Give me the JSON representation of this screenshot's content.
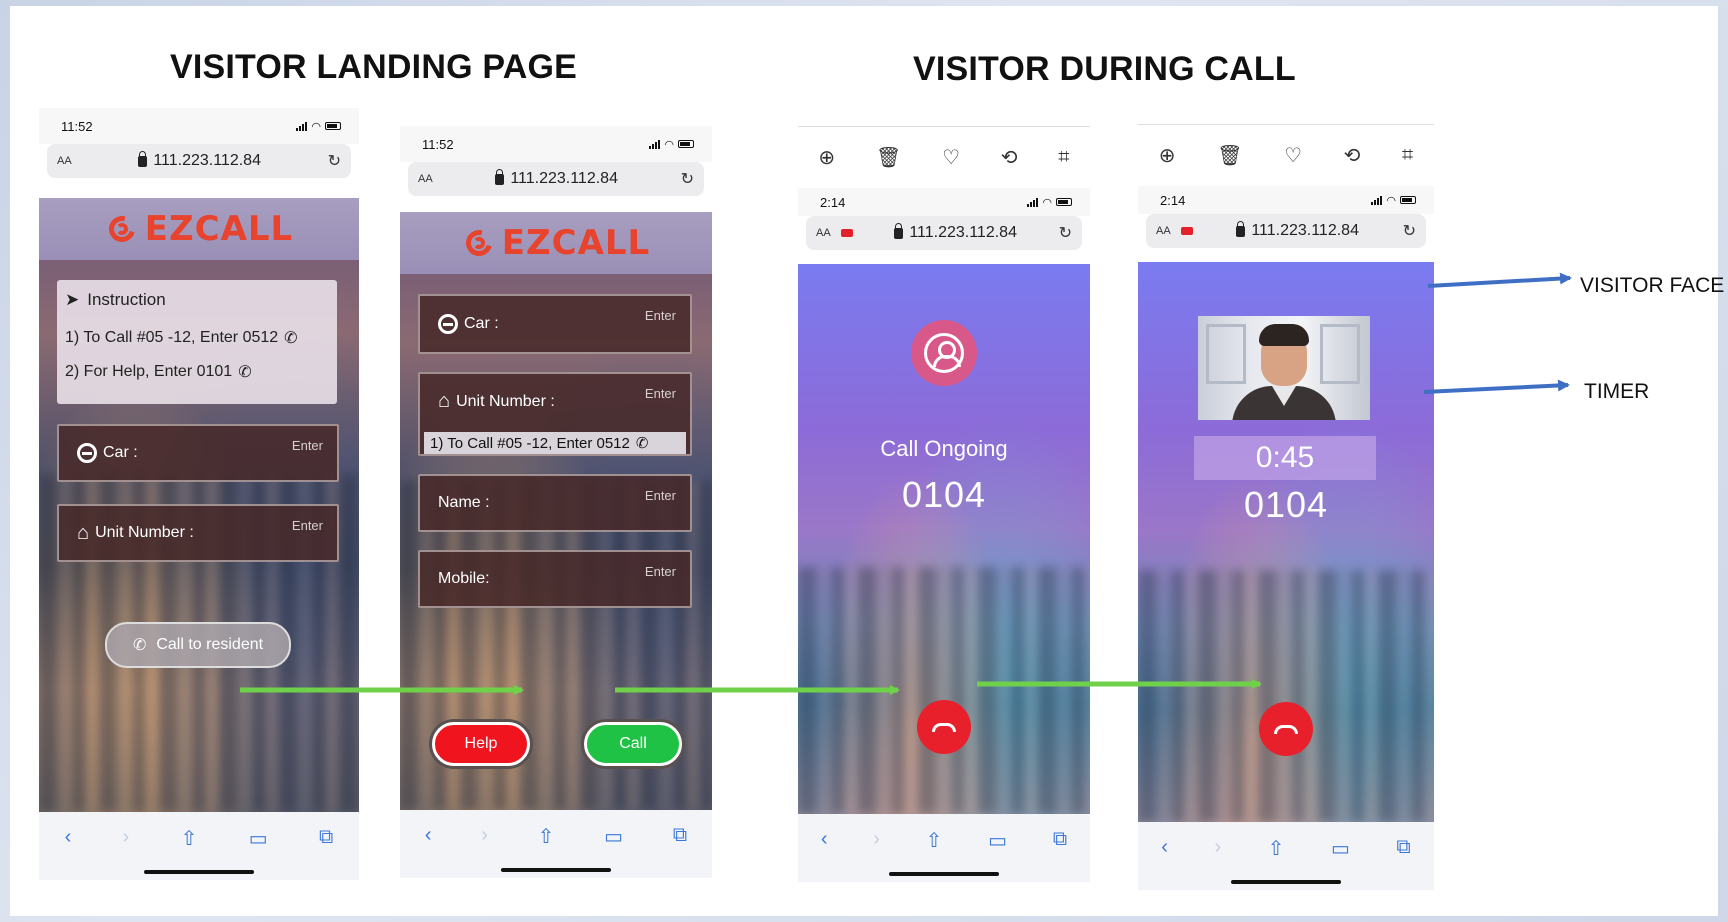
{
  "headings": {
    "landing": "VISITOR LANDING PAGE",
    "during_call": "VISITOR DURING CALL"
  },
  "phone1": {
    "time": "11:52",
    "url_aa": "AA",
    "url": "111.223.112.84",
    "logo": "EZCALL",
    "instruction_title": "Instruction",
    "instruction_lines": [
      "1) To Call #05 -12, Enter 0512",
      "2) For Help, Enter 0101"
    ],
    "field_car": "Car :",
    "field_unit": "Unit Number :",
    "enter_hint": "Enter",
    "call_button": "Call to resident"
  },
  "phone2": {
    "time": "11:52",
    "url_aa": "AA",
    "url": "111.223.112.84",
    "logo": "EZCALL",
    "field_car": "Car :",
    "field_unit": "Unit Number :",
    "unit_hint": "1) To Call #05 -12, Enter 0512",
    "field_name": "Name :",
    "field_mobile": "Mobile:",
    "enter_hint": "Enter",
    "help_button": "Help",
    "call_button": "Call"
  },
  "phone3": {
    "time": "2:14",
    "url_aa": "AA",
    "url": "111.223.112.84",
    "status": "Call Ongoing",
    "number": "0104"
  },
  "phone4": {
    "time": "2:14",
    "url_aa": "AA",
    "url": "111.223.112.84",
    "timer": "0:45",
    "number": "0104"
  },
  "annotations": {
    "visitor_face": "VISITOR FACE",
    "timer": "TIMER"
  },
  "colors": {
    "logo": "#e8432c",
    "hangup": "#e8202c",
    "help": "#f0141e",
    "call": "#1fc244",
    "arrow_green": "#6fd14a",
    "arrow_blue": "#3f6fc4"
  }
}
